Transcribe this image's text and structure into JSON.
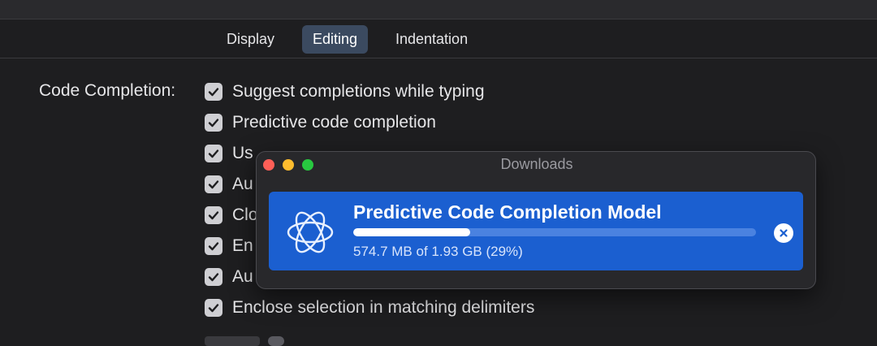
{
  "tabs": [
    {
      "label": "Display",
      "active": false
    },
    {
      "label": "Editing",
      "active": true
    },
    {
      "label": "Indentation",
      "active": false
    }
  ],
  "code_completion": {
    "label": "Code Completion:",
    "options": [
      {
        "label": "Suggest completions while typing",
        "checked": true
      },
      {
        "label": "Predictive code completion",
        "checked": true
      },
      {
        "label": "Use Escape key to show completion suggestions",
        "visible_text": "Us",
        "checked": true
      },
      {
        "label": "Au",
        "checked": true
      },
      {
        "label": "Clo",
        "checked": true
      },
      {
        "label": "En",
        "checked": true
      },
      {
        "label": "Au",
        "checked": true
      },
      {
        "label": "Enclose selection in matching delimiters",
        "checked": true
      }
    ]
  },
  "downloads": {
    "title": "Downloads",
    "item": {
      "name": "Predictive Code Completion Model",
      "status": "574.7 MB of 1.93 GB (29%)",
      "progress_percent": 29
    },
    "icons": {
      "model": "atom-orbit-icon",
      "cancel": "close-circle-icon"
    }
  },
  "colors": {
    "accent": "#1b5fd0",
    "tab_active": "#3b4a60",
    "close": "#ff5f57",
    "minimize": "#febc2e",
    "zoom": "#28c840"
  }
}
